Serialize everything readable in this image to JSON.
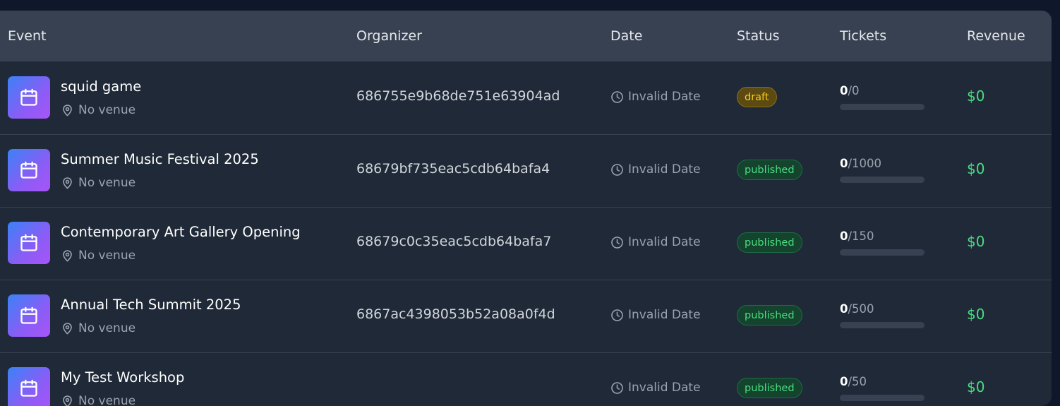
{
  "table": {
    "headers": {
      "event": "Event",
      "organizer": "Organizer",
      "date": "Date",
      "status": "Status",
      "tickets": "Tickets",
      "revenue": "Revenue"
    },
    "ticket_separator": "/",
    "rows": [
      {
        "title": "squid game",
        "venue": "No venue",
        "organizer": "686755e9b68de751e63904ad",
        "date": "Invalid Date",
        "status": "draft",
        "tickets_sold": "0",
        "tickets_capacity": "0",
        "sold_fraction": 0,
        "revenue": "$0"
      },
      {
        "title": "Summer Music Festival 2025",
        "venue": "No venue",
        "organizer": "68679bf735eac5cdb64bafa4",
        "date": "Invalid Date",
        "status": "published",
        "tickets_sold": "0",
        "tickets_capacity": "1000",
        "sold_fraction": 0,
        "revenue": "$0"
      },
      {
        "title": "Contemporary Art Gallery Opening",
        "venue": "No venue",
        "organizer": "68679c0c35eac5cdb64bafa7",
        "date": "Invalid Date",
        "status": "published",
        "tickets_sold": "0",
        "tickets_capacity": "150",
        "sold_fraction": 0,
        "revenue": "$0"
      },
      {
        "title": "Annual Tech Summit 2025",
        "venue": "No venue",
        "organizer": "6867ac4398053b52a08a0f4d",
        "date": "Invalid Date",
        "status": "published",
        "tickets_sold": "0",
        "tickets_capacity": "500",
        "sold_fraction": 0,
        "revenue": "$0"
      },
      {
        "title": "My Test Workshop",
        "venue": "No venue",
        "organizer": "",
        "date": "Invalid Date",
        "status": "published",
        "tickets_sold": "0",
        "tickets_capacity": "50",
        "sold_fraction": 0,
        "revenue": "$0"
      }
    ]
  },
  "icons": {
    "event": "calendar-icon",
    "venue": "map-pin-icon",
    "date": "clock-icon"
  },
  "colors": {
    "background": "#0f172a",
    "panel": "#1f2937",
    "header": "#374151",
    "revenue": "#4ade80",
    "draft": "#facc15",
    "published": "#4ade80",
    "icon_gradient_start": "#3b82f6",
    "icon_gradient_end": "#a855f7"
  }
}
